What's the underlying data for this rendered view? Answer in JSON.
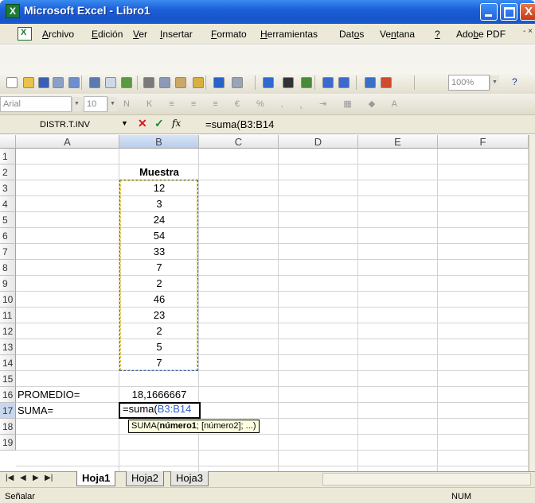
{
  "window": {
    "title": "Microsoft Excel - Libro1",
    "close_glyph": "X"
  },
  "menu": {
    "items": [
      {
        "pre": "",
        "key": "A",
        "post": "rchivo"
      },
      {
        "pre": "",
        "key": "E",
        "post": "dición"
      },
      {
        "pre": "",
        "key": "V",
        "post": "er"
      },
      {
        "pre": "",
        "key": "I",
        "post": "nsertar"
      },
      {
        "pre": "",
        "key": "F",
        "post": "ormato"
      },
      {
        "pre": "",
        "key": "H",
        "post": "erramientas"
      },
      {
        "pre": "Dat",
        "key": "o",
        "post": "s"
      },
      {
        "pre": "Ve",
        "key": "n",
        "post": "tana"
      },
      {
        "pre": "",
        "key": "?",
        "post": ""
      },
      {
        "pre": "Ado",
        "key": "b",
        "post": "e PDF"
      }
    ],
    "doc_controls": "- ×"
  },
  "toolbar": {
    "zoom": "100%",
    "font": "Arial",
    "size": "10",
    "icons": [
      "new-icon",
      "open-icon",
      "save-icon",
      "permission-icon",
      "mail-icon",
      "print-icon",
      "preview-icon",
      "spelling-icon",
      "cut-icon",
      "copy-icon",
      "paste-icon",
      "format-painter-icon",
      "undo-icon",
      "redo-icon",
      "hyperlink-icon",
      "autosum-icon",
      "chart-wizard-icon",
      "sort-asc-icon",
      "sort-desc-icon",
      "chart-icon",
      "drawing-icon"
    ]
  },
  "formula_bar": {
    "name_box": "DISTR.T.INV",
    "fx": "fx",
    "formula": "=suma(B3:B14"
  },
  "grid": {
    "columns": [
      "A",
      "B",
      "C",
      "D",
      "E",
      "F"
    ],
    "rows": [
      "1",
      "2",
      "3",
      "4",
      "5",
      "6",
      "7",
      "8",
      "9",
      "10",
      "11",
      "12",
      "13",
      "14",
      "15",
      "16",
      "17",
      "18",
      "19"
    ],
    "header_b2": "Muestra",
    "values": [
      "12",
      "3",
      "24",
      "54",
      "33",
      "7",
      "2",
      "46",
      "23",
      "2",
      "5",
      "7"
    ],
    "promedio_label": "PROMEDIO=",
    "promedio_value": "18,1666667",
    "suma_label": "SUMA=",
    "edit_prefix": "=suma(",
    "edit_range": "B3:B14",
    "tooltip_func": "SUMA(",
    "tooltip_arg1": "número1",
    "tooltip_rest": "; [número2]; ...)"
  },
  "sheets": [
    "Hoja1",
    "Hoja2",
    "Hoja3"
  ],
  "status": {
    "mode": "Señalar",
    "num": "NUM"
  },
  "colors": {
    "title_blue": "#1c5fd8",
    "range_blue": "#2f5fd0",
    "excel_green": "#1d7a35"
  }
}
